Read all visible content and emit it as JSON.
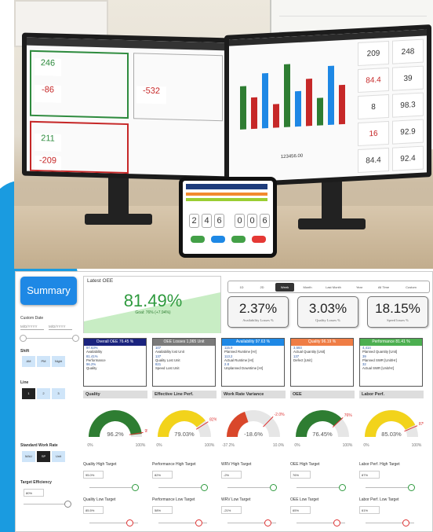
{
  "photo": {
    "left_monitor": {
      "tiles": [
        {
          "value": "246",
          "color": "#2e8b3e"
        },
        {
          "value": "-86",
          "color": "#c62828"
        },
        {
          "value": "211",
          "color": "#2e8b3e"
        },
        {
          "value": "-209",
          "color": "#c62828"
        },
        {
          "value": "-532",
          "color": "#c62828"
        }
      ]
    },
    "right_monitor": {
      "kpis": [
        "209",
        "248",
        "84.4",
        "39",
        "8",
        "98.3",
        "16",
        "92.9",
        "84.4",
        "92.4"
      ],
      "footer": "123456.00"
    },
    "tablet": {
      "digits": [
        "2",
        "4",
        "6",
        "0",
        "0",
        "6"
      ]
    }
  },
  "sidebar": {
    "title": "Summary",
    "custom_date_label": "Custom Date",
    "date_from": "M/D/YYYY",
    "date_to": "M/D/YYYY",
    "shift_label": "Shift",
    "shift_options": [
      "AM",
      "PM",
      "Night"
    ],
    "line_label": "Line",
    "line_options": [
      "1",
      "2",
      "3"
    ],
    "swr_label": "Standard Work Rate",
    "swr_options": [
      "MAU",
      "SP",
      "Unit"
    ],
    "target_eff_label": "Target Efficiency",
    "target_eff_value": "80%"
  },
  "latest_oee": {
    "title": "Latest OEE",
    "value": "81.49%",
    "goal": "Goal: 76% (+7.94%)"
  },
  "time_filters": {
    "options": [
      "1D",
      "2D",
      "Week",
      "Month",
      "Last Month",
      "Year",
      "All Time",
      "Custom"
    ],
    "active": "Week"
  },
  "losses": [
    {
      "value": "2.37%",
      "label": "Availability Losses %"
    },
    {
      "value": "3.03%",
      "label": "Quality Losses %"
    },
    {
      "value": "18.15%",
      "label": "Speed losses %"
    }
  ],
  "cards": [
    {
      "title": "Overall OEE 76.45 %",
      "color": "#1a237e",
      "rows": [
        [
          "97.63%",
          "Availability"
        ],
        [
          "81.41%",
          "Performance"
        ],
        [
          "96.2%",
          "Quality"
        ]
      ]
    },
    {
      "title": "OEE Losses 1,065 Unit",
      "color": "#7a7a7a",
      "rows": [
        [
          "107",
          "Availability lost Unit"
        ],
        [
          "137",
          "Quality Lost Unit"
        ],
        [
          "821",
          "Speed Lost Unit"
        ]
      ]
    },
    {
      "title": "Availability 97.63 %",
      "color": "#1e88e5",
      "rows": [
        [
          "115.9",
          "Planned Runtime [Hr]"
        ],
        [
          "113.2",
          "Actual Runtime [Hr]"
        ],
        [
          "2.8",
          "Unplanned Downtime [Hr]"
        ]
      ]
    },
    {
      "title": "Quality 96.19 %",
      "color": "#ef7d45",
      "rows": [
        [
          "3,593",
          "Actual Quantity [Unit]"
        ],
        [
          "137",
          "Defect [Unit]"
        ]
      ]
    },
    {
      "title": "Performance 81.41 %",
      "color": "#4caf50",
      "rows": [
        [
          "4,414",
          "Planned Quantity [Unit]"
        ],
        [
          "39",
          "Planned SWR [Unit/Hr]"
        ],
        [
          "32",
          "Actual SWR [Unit/Hr]"
        ]
      ]
    }
  ],
  "gauges": [
    {
      "title": "Quality",
      "value": "96.2%",
      "target": "95.0%",
      "min": "0%",
      "max": "100%",
      "color": "#2e7d32",
      "fill": 0.962,
      "tmark": 0.95,
      "high_label": "Quality High Target",
      "high": "95.0%",
      "low_label": "Quality Low Target",
      "low": "85.5%"
    },
    {
      "title": "Effective Line Perf.",
      "value": "79.03%",
      "target": "82%",
      "min": "0%",
      "max": "100%",
      "color": "#f2d31b",
      "fill": 0.7903,
      "tmark": 0.82,
      "high_label": "Performance High Target",
      "high": "82%",
      "low_label": "Performance Low Target",
      "low": "58%"
    },
    {
      "title": "Work Rate Variance",
      "value": "-18.6%",
      "target": "-2.0%",
      "min": "-37.2%",
      "max": "10.0%",
      "color": "#d9472b",
      "fill": 0.395,
      "tmark": 0.746,
      "high_label": "WRV High Target",
      "high": "-2%",
      "low_label": "WRV Low Target",
      "low": "-21%"
    },
    {
      "title": "OEE",
      "value": "76.45%",
      "target": "76%",
      "min": "0%",
      "max": "100%",
      "color": "#2e7d32",
      "fill": 0.7645,
      "tmark": 0.76,
      "high_label": "OEE High Target",
      "high": "76%",
      "low_label": "OEE Low Target",
      "low": "65%"
    },
    {
      "title": "Labor Perf.",
      "value": "85.03%",
      "target": "87%",
      "min": "0%",
      "max": "100%",
      "color": "#f2d31b",
      "fill": 0.8503,
      "tmark": 0.87,
      "high_label": "Labor Perf. High Target",
      "high": "87%",
      "low_label": "Labor Perf. Low Target",
      "low": "61%"
    }
  ]
}
